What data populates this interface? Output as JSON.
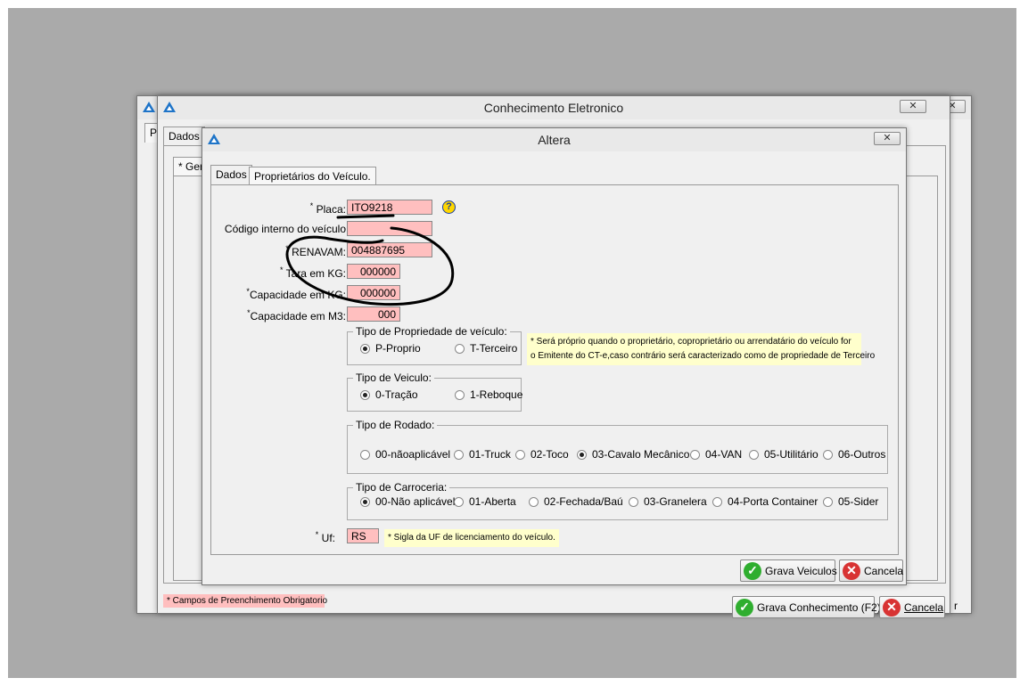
{
  "background_window": {
    "tab_fragment": "P"
  },
  "main_window": {
    "title": "Conhecimento Eletronico",
    "close_label": "✕",
    "tab_dados": "Dados",
    "subtab_fragment": "* Gera",
    "required_note": "* Campos de Preenchimento Obrigatorio",
    "save_button": "Grava Conhecimento (F2)",
    "cancel_button": "Cancela",
    "cancel_button_hint": "r"
  },
  "dialog": {
    "title": "Altera",
    "close_label": "✕",
    "tabs": [
      "Dados",
      "Proprietários do Veículo."
    ],
    "fields": {
      "placa": {
        "label": "Placa:",
        "value": "ITO9218"
      },
      "codigo_interno": {
        "label": "Código interno do veículo",
        "value": ""
      },
      "renavam": {
        "label": "RENAVAM:",
        "value": "004887695"
      },
      "tara": {
        "label": "Tara em KG:",
        "value": "000000"
      },
      "capacidade_kg": {
        "label": "Capacidade em KG:",
        "value": "000000"
      },
      "capacidade_m3": {
        "label": "Capacidade em M3:",
        "value": "000"
      },
      "uf": {
        "label": "Uf:",
        "value": "RS"
      }
    },
    "required_mark": "*",
    "help_icon": "?",
    "tipo_propriedade": {
      "title": "Tipo de Propriedade de veículo:",
      "options": [
        "P-Proprio",
        "T-Terceiro"
      ],
      "selected": "P-Proprio",
      "note_line1": "* Será próprio quando o proprietário, coproprietário ou arrendatário do veículo for",
      "note_line2": "o Emitente do CT-e,caso contrário será caracterizado como de propriedade de Terceiro"
    },
    "tipo_veiculo": {
      "title": "Tipo de Veiculo:",
      "options": [
        "0-Tração",
        "1-Reboque"
      ],
      "selected": "0-Tração"
    },
    "tipo_rodado": {
      "title": "Tipo de Rodado:",
      "options": [
        "00-nãoaplicável",
        "01-Truck",
        "02-Toco",
        "03-Cavalo Mecânico",
        "04-VAN",
        "05-Utilitário",
        "06-Outros"
      ],
      "selected": "03-Cavalo Mecânico"
    },
    "tipo_carroceria": {
      "title": "Tipo de Carroceria:",
      "options": [
        "00-Não aplicável",
        "01-Aberta",
        "02-Fechada/Baú",
        "03-Granelera",
        "04-Porta Container",
        "05-Sider"
      ],
      "selected": "00-Não aplicável"
    },
    "uf_note": "* Sigla da UF de licenciamento do veículo.",
    "save_button": "Grava Veiculos",
    "cancel_button": "Cancela"
  },
  "icons": {
    "app": "app-logo-icon",
    "ok": "check-icon",
    "cancel": "x-circle-icon"
  },
  "colors": {
    "required_field": "#ffbfbf",
    "note": "#ffffcc",
    "desktop": "#aaaaaa"
  }
}
